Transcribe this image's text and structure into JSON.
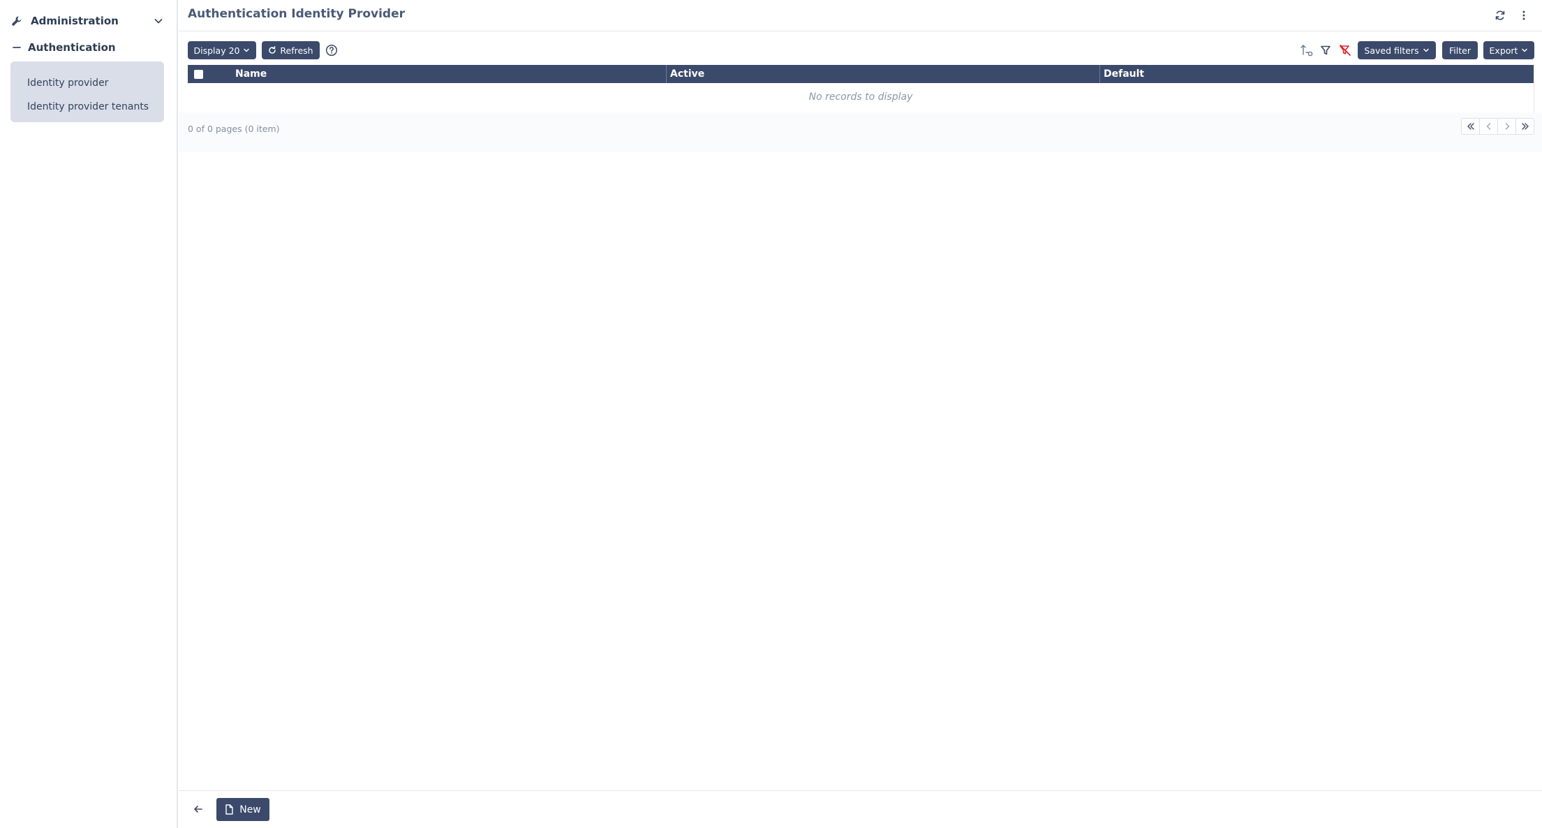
{
  "sidebar": {
    "section_label": "Administration",
    "group_label": "Authentication",
    "items": [
      {
        "label": "Identity provider"
      },
      {
        "label": "Identity provider tenants"
      }
    ]
  },
  "header": {
    "title": "Authentication Identity Provider"
  },
  "toolbar": {
    "display_label": "Display 20",
    "refresh_label": "Refresh",
    "saved_filters_label": "Saved filters",
    "filter_label": "Filter",
    "export_label": "Export"
  },
  "table": {
    "columns": [
      "Name",
      "Active",
      "Default"
    ],
    "empty_message": "No records to display"
  },
  "pagination": {
    "summary": "0 of 0 pages (0 item)"
  },
  "footer": {
    "new_label": "New"
  },
  "icons": {
    "admin": "wrench-icon",
    "sync": "sync-icon",
    "more": "more-vertical-icon",
    "help": "help-circle-icon",
    "sort": "sort-options-icon",
    "filter": "funnel-icon",
    "clear_filter": "funnel-clear-icon",
    "back": "arrow-left-icon",
    "new": "file-icon"
  },
  "colors": {
    "primary": "#3b4a6b",
    "sidebar_group_bg": "#d9dee9",
    "clear_filter": "#d9272e"
  }
}
